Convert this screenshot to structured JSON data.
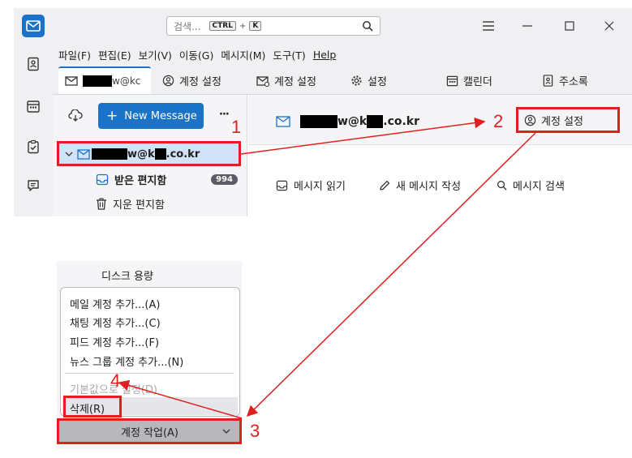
{
  "window": {
    "search_placeholder": "검색...",
    "shortcut_ctrl": "CTRL",
    "shortcut_plus": "+",
    "shortcut_key": "K"
  },
  "menubar": [
    "파일(F)",
    "편집(E)",
    "보기(V)",
    "이동(G)",
    "메시지(M)",
    "도구(T)",
    "Help"
  ],
  "tabs": [
    {
      "label": "w@kc",
      "icon": "mail-icon",
      "active": true
    },
    {
      "label": "계정 설정",
      "icon": "account-settings-icon"
    },
    {
      "label": "계정 설정",
      "icon": "mail-settings-icon"
    },
    {
      "label": "설정",
      "icon": "gear-icon"
    },
    {
      "label": "캘린더",
      "icon": "calendar-icon"
    },
    {
      "label": "주소록",
      "icon": "address-book-icon"
    }
  ],
  "folder_pane": {
    "new_message": "New Message",
    "more": "···",
    "account": "w@k",
    "account_suffix": ".co.kr",
    "folders": [
      {
        "name": "받은 편지함",
        "count": "994",
        "icon": "inbox-icon"
      },
      {
        "name": "지운 편지함",
        "icon": "trash-icon"
      }
    ]
  },
  "account_central": {
    "account_email_a": "w@k",
    "account_email_b": ".co.kr",
    "account_settings": "계정 설정",
    "actions": [
      "메시지 읽기",
      "새 메시지 작성",
      "메시지 검색"
    ]
  },
  "menu_popup": {
    "disk_usage": "디스크 용량",
    "items": [
      "메일 계정 추가...(A)",
      "채팅 계정 추가...(C)",
      "피드 계정 추가...(F)",
      "뉴스 그룹 계정 추가...(N)"
    ],
    "disabled_item": "기본값으로 설정(D)",
    "delete_item": "삭제(R)",
    "account_actions": "계정 작업(A)"
  },
  "annotations": [
    "1",
    "2",
    "3",
    "4"
  ],
  "colors": {
    "accent": "#1a73c8",
    "annotation": "#e02020",
    "spaces_bar": "#f0f0f3"
  }
}
